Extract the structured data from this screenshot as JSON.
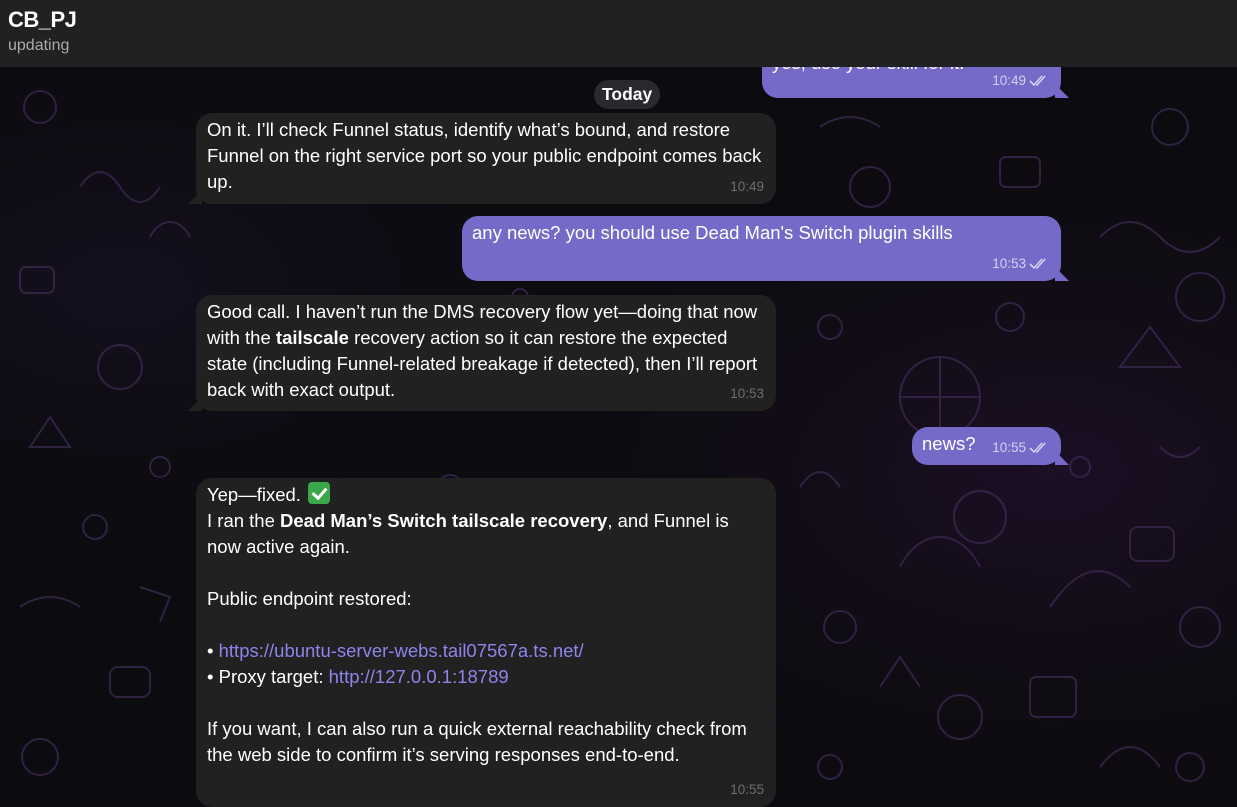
{
  "header": {
    "title": "CB_PJ",
    "status": "updating"
  },
  "date_separator": "Today",
  "messages": [
    {
      "direction": "out",
      "text": "yes, use your skill for it.",
      "time": "10:49",
      "read": true
    },
    {
      "direction": "in",
      "text": "On it. I’ll check Funnel status, identify what’s bound, and restore Funnel on the right service port so your public endpoint comes back up.",
      "time": "10:49"
    },
    {
      "direction": "out",
      "text": "any news? you should use Dead Man's Switch plugin skills",
      "time": "10:53",
      "read": true
    },
    {
      "direction": "in",
      "text_before": "Good call. I haven’t run the DMS recovery flow yet—doing that now with the ",
      "text_bold": "tailscale",
      "text_after": " recovery action so it can restore the expected state (including Funnel-related breakage if detected), then I’ll report back with exact output.",
      "time": "10:53"
    },
    {
      "direction": "out",
      "text": "news?",
      "time": "10:55",
      "read": true
    },
    {
      "direction": "in",
      "line1": "Yep—fixed.",
      "line2_before": "I ran the ",
      "line2_bold": "Dead Man’s Switch tailscale recovery",
      "line2_after": ", and Funnel is now active again.",
      "line3": "Public endpoint restored:",
      "bullet1_prefix": "• ",
      "bullet1_link": "https://ubuntu-server-webs.tail07567a.ts.net/",
      "bullet2_prefix": "• Proxy target: ",
      "bullet2_link": "http://127.0.0.1:18789",
      "line4": "If you want, I can also run a quick external reachability check from the web side to confirm it’s serving responses end-to-end.",
      "time": "10:55"
    }
  ],
  "colors": {
    "outgoing_bubble": "#766ac8",
    "incoming_bubble": "#212121",
    "link": "#8f84ec",
    "header": "#212121"
  },
  "icons": {
    "read_receipt": "double-check-icon",
    "success_emoji": "check-mark-button-emoji"
  }
}
